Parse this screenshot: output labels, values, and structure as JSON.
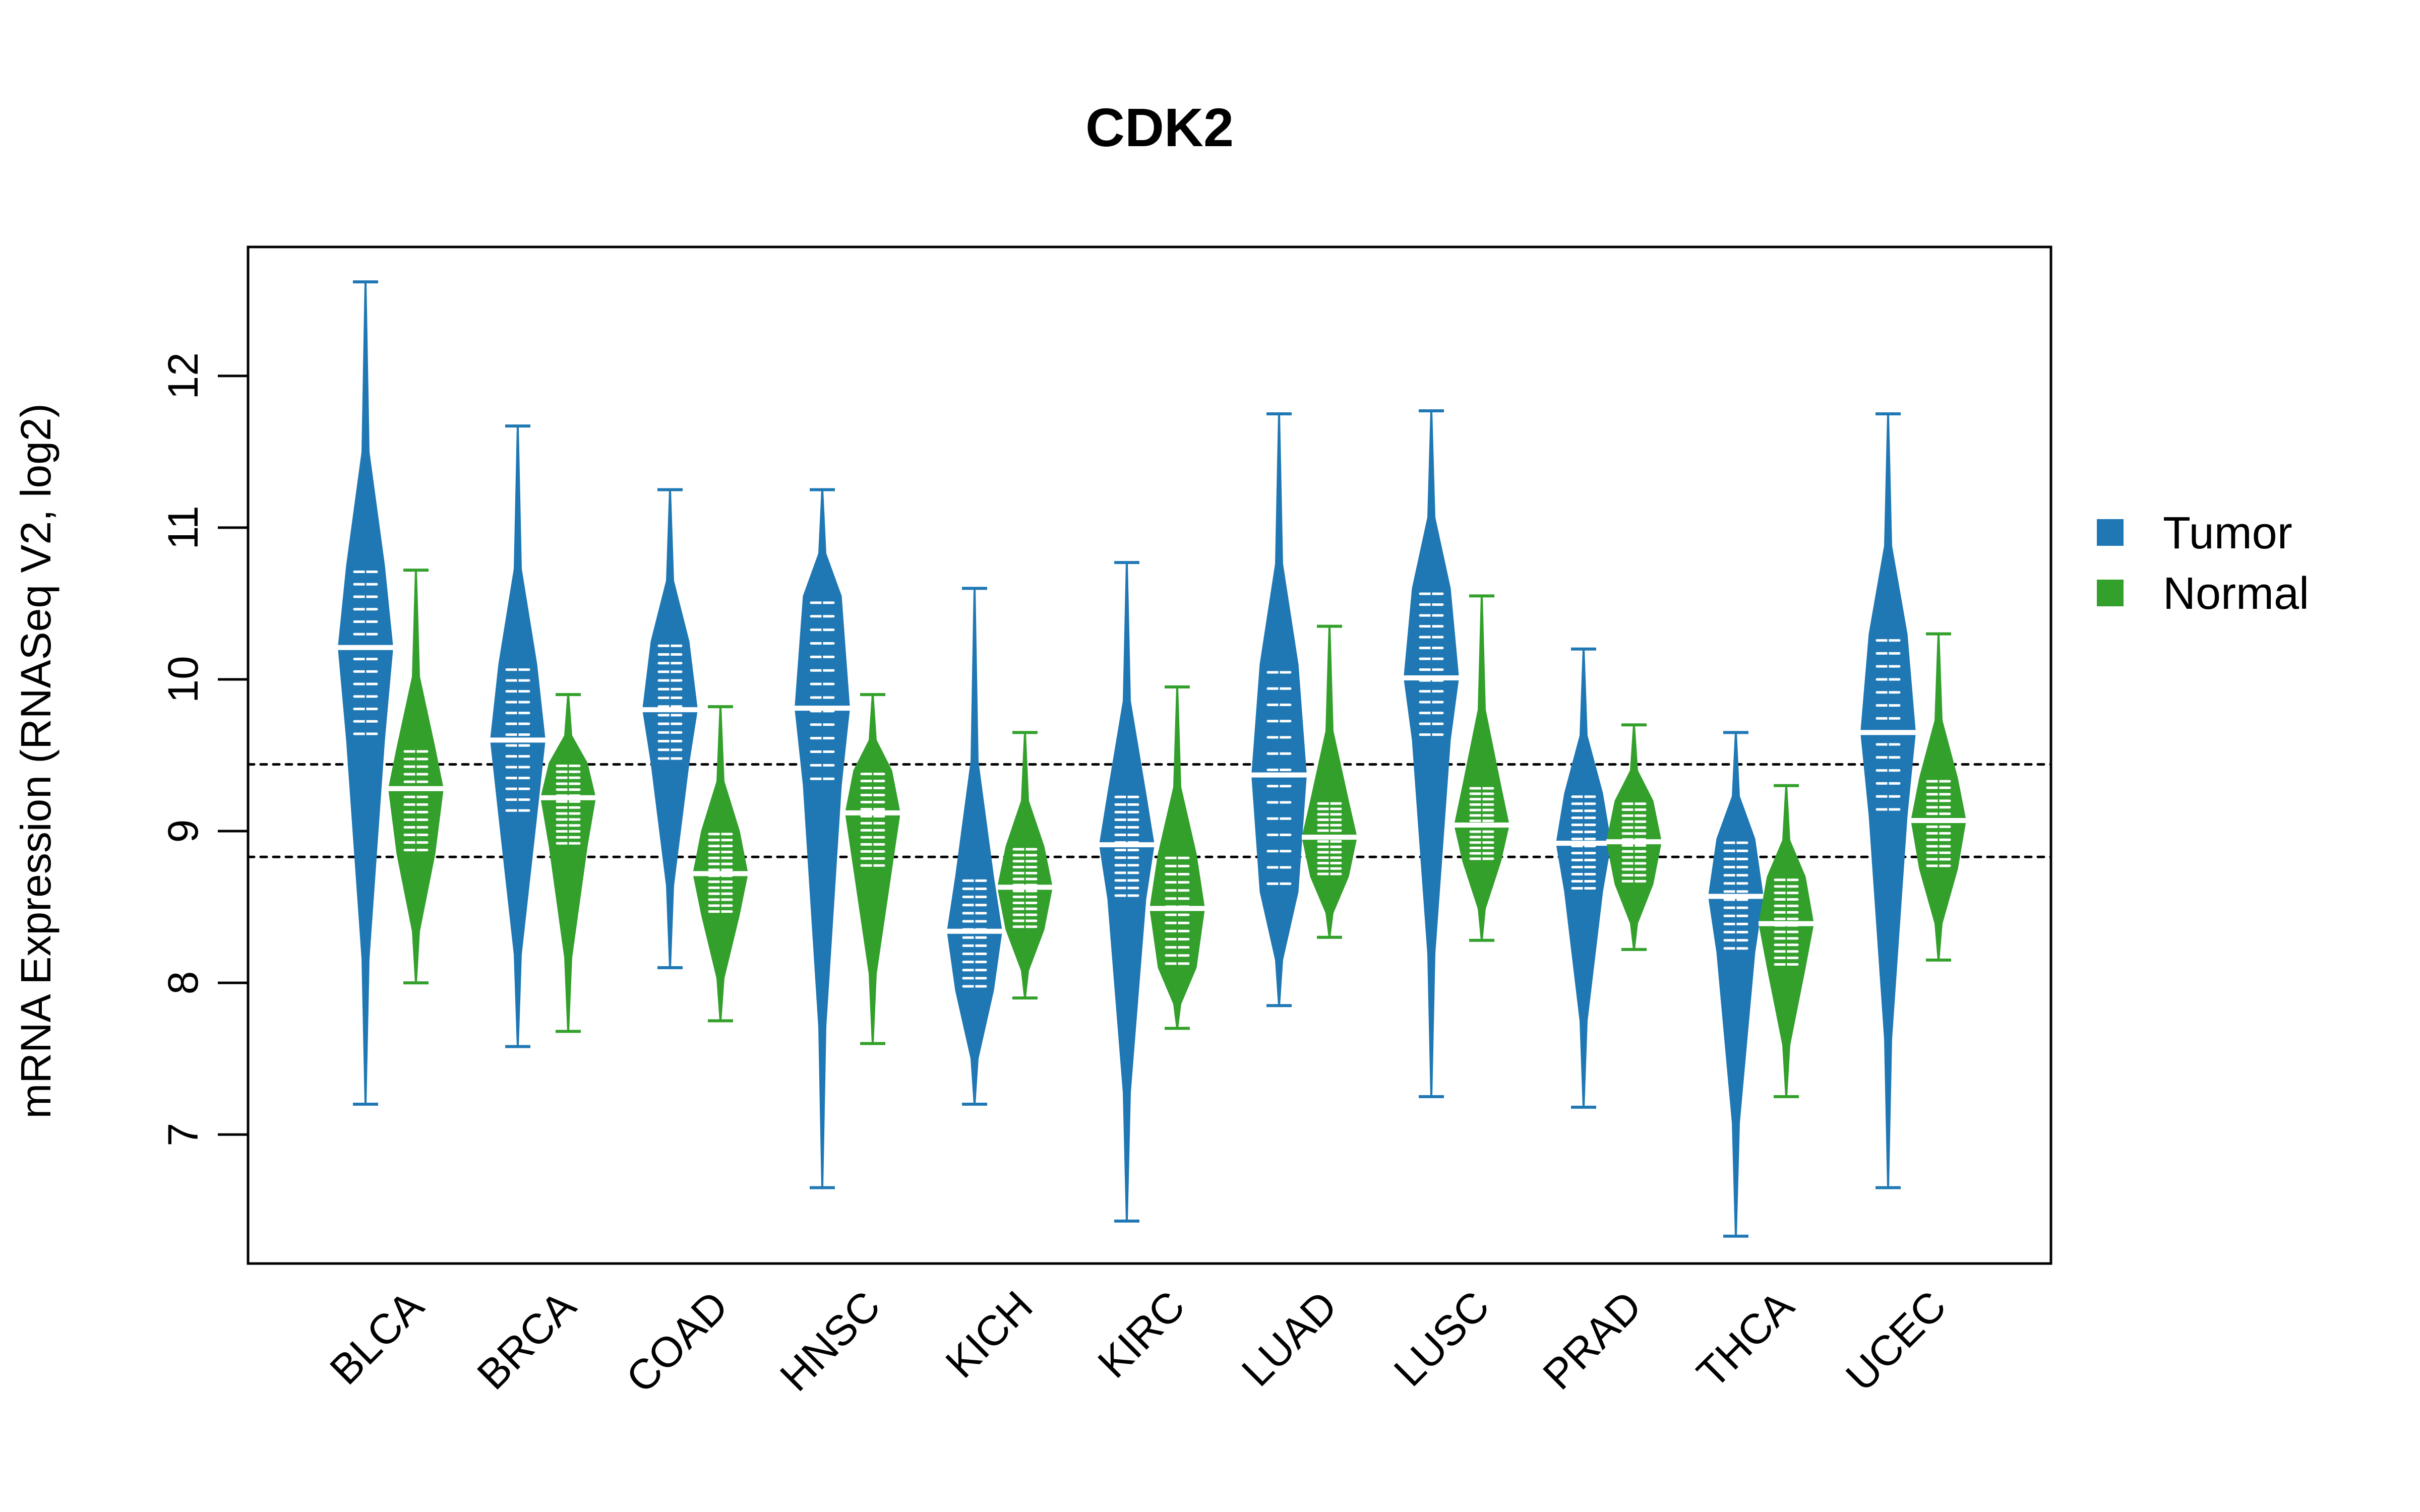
{
  "chart_data": {
    "type": "violin",
    "title": "CDK2",
    "xlabel": "",
    "ylabel": "mRNA Expression (RNASeq V2, log2)",
    "ylim": [
      6.15,
      12.85
    ],
    "yticks": [
      7,
      8,
      9,
      10,
      11,
      12
    ],
    "grid": false,
    "legend_position": "right",
    "reference_lines": [
      9.44,
      8.83
    ],
    "categories": [
      "BLCA",
      "BRCA",
      "COAD",
      "HNSC",
      "KICH",
      "KIRC",
      "LUAD",
      "LUSC",
      "PRAD",
      "THCA",
      "UCEC"
    ],
    "series": [
      {
        "name": "Tumor",
        "color": "#1F78B4",
        "median": [
          10.21,
          9.6,
          9.8,
          9.81,
          8.34,
          8.91,
          9.37,
          10.01,
          8.92,
          8.57,
          9.65
        ],
        "min": [
          7.2,
          7.58,
          8.1,
          6.65,
          7.2,
          6.43,
          7.85,
          7.25,
          7.18,
          6.33,
          6.65
        ],
        "max": [
          12.62,
          11.67,
          11.25,
          11.25,
          10.6,
          10.77,
          11.75,
          11.77,
          10.2,
          9.65,
          11.75
        ],
        "q1": [
          9.6,
          9.1,
          9.45,
          9.3,
          7.95,
          8.55,
          8.6,
          9.6,
          8.6,
          8.2,
          9.1
        ],
        "q3": [
          10.75,
          10.1,
          10.25,
          10.55,
          8.7,
          9.25,
          10.1,
          10.6,
          9.25,
          8.95,
          10.3
        ]
      },
      {
        "name": "Normal",
        "color": "#33A02C",
        "median": [
          9.28,
          9.22,
          8.72,
          9.12,
          8.63,
          8.49,
          8.96,
          9.04,
          8.93,
          8.39,
          9.07
        ],
        "min": [
          8.0,
          7.68,
          7.75,
          7.6,
          7.9,
          7.7,
          8.3,
          8.28,
          8.22,
          7.25,
          8.15
        ],
        "max": [
          10.72,
          9.9,
          9.82,
          9.9,
          9.65,
          9.95,
          10.35,
          10.55,
          9.7,
          9.3,
          10.3
        ],
        "q1": [
          8.85,
          8.9,
          8.45,
          8.75,
          8.35,
          8.1,
          8.7,
          8.8,
          8.65,
          8.1,
          8.75
        ],
        "q3": [
          9.55,
          9.45,
          9.0,
          9.4,
          8.9,
          8.85,
          9.2,
          9.3,
          9.2,
          8.7,
          9.35
        ]
      }
    ]
  }
}
